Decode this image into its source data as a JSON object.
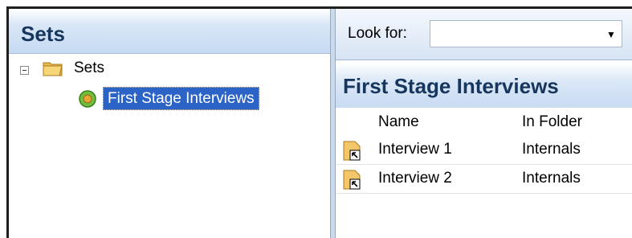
{
  "left_pane": {
    "title": "Sets",
    "tree": {
      "root_label": "Sets",
      "root_expanded": true,
      "selected_item_label": "First Stage Interviews"
    }
  },
  "right_pane": {
    "look_for": {
      "label": "Look for:",
      "value": ""
    },
    "heading": "First Stage Interviews",
    "columns": [
      "Name",
      "In Folder"
    ],
    "rows": [
      {
        "name": "Interview 1",
        "folder": "Internals"
      },
      {
        "name": "Interview 2",
        "folder": "Internals"
      }
    ]
  },
  "colors": {
    "selection": "#2b63c6",
    "header_text": "#17365d",
    "header_band": "#c6daf2"
  },
  "icons": {
    "tree_expander": "minus-box-icon",
    "root": "folder-icon",
    "set": "set-icon",
    "row": "document-shortcut-icon",
    "combo": "dropdown-arrow-icon"
  }
}
